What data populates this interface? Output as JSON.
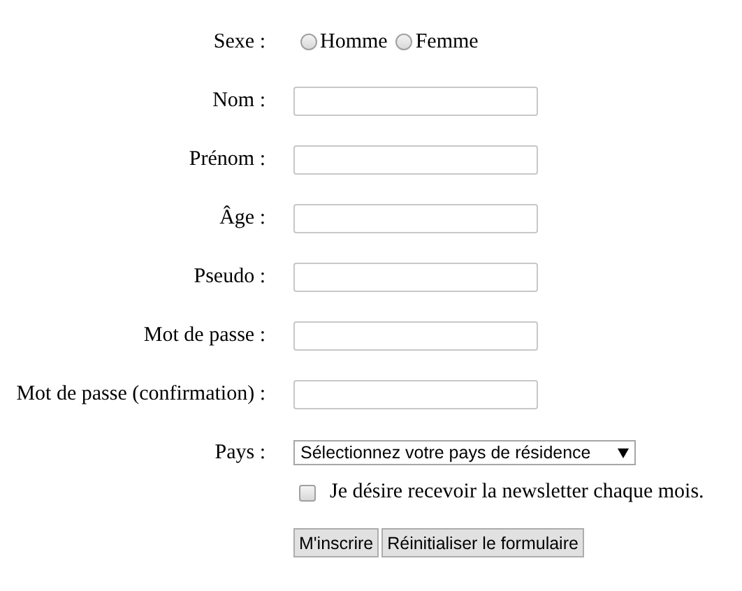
{
  "fields": [
    {
      "kind": "radio",
      "label": "Sexe :",
      "options": [
        {
          "label": "Homme",
          "selected": false
        },
        {
          "label": "Femme",
          "selected": false
        }
      ]
    },
    {
      "kind": "text",
      "label": "Nom :"
    },
    {
      "kind": "text",
      "label": "Prénom :"
    },
    {
      "kind": "text",
      "label": "Âge :"
    },
    {
      "kind": "text",
      "label": "Pseudo :"
    },
    {
      "kind": "password",
      "label": "Mot de passe :"
    },
    {
      "kind": "password",
      "label": "Mot de passe (confirmation) :"
    },
    {
      "kind": "select",
      "label": "Pays :",
      "value": "Sélectionnez votre pays de résidence"
    }
  ],
  "newsletter": {
    "label": "Je désire recevoir la newsletter chaque mois.",
    "checked": false
  },
  "buttons": [
    "M'inscrire",
    "Réinitialiser le formulaire"
  ]
}
